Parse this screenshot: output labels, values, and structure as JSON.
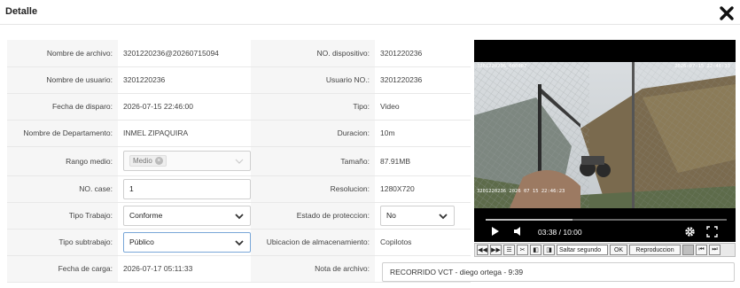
{
  "header": {
    "title": "Detalle",
    "close_icon": "close-x-icon"
  },
  "fields": {
    "nombre_archivo": {
      "label": "Nombre de archivo:",
      "value": "3201220236@20260715094"
    },
    "no_dispositivo": {
      "label": "NO. dispositivo:",
      "value": "3201220236"
    },
    "nombre_usuario": {
      "label": "Nombre de usuario:",
      "value": "3201220236"
    },
    "usuario_no": {
      "label": "Usuario NO.:",
      "value": "3201220236"
    },
    "fecha_disparo": {
      "label": "Fecha de disparo:",
      "value": "2026-07-15 22:46:00"
    },
    "tipo": {
      "label": "Tipo:",
      "value": "Video"
    },
    "nombre_departamento": {
      "label": "Nombre de Departamento:",
      "value": "INMEL ZIPAQUIRA"
    },
    "duracion": {
      "label": "Duracion:",
      "value": "10m"
    },
    "rango_medio": {
      "label": "Rango medio:",
      "value": "Medio"
    },
    "tamano": {
      "label": "Tamaño:",
      "value": "87.91MB"
    },
    "no_case": {
      "label": "NO. case:",
      "value": "1"
    },
    "resolucion": {
      "label": "Resolucion:",
      "value": "1280X720"
    },
    "tipo_trabajo": {
      "label": "Tipo Trabajo:",
      "value": "Conforme"
    },
    "estado_proteccion": {
      "label": "Estado de proteccion:",
      "value": "No"
    },
    "tipo_subtrabajo": {
      "label": "Tipo subtrabajo:",
      "value": "Público"
    },
    "ubicacion_almacenamiento": {
      "label": "Ubicacion de almacenamiento:",
      "value": "Copilotos"
    },
    "fecha_carga": {
      "label": "Fecha de carga:",
      "value": "2026-07-17 05:11:33"
    },
    "nota_archivo": {
      "label": "Nota de archivo:",
      "value": "RECORRIDO VCT - diego ortega - 9:39"
    }
  },
  "player": {
    "osd_left": "3201220236_000007",
    "osd_right": "2026-07-15 22:46:33",
    "osd_bottom_left": "3201220236 2026 07 15 22:46:23",
    "current_time": "03:38",
    "total_time": "10:00",
    "time_display": "03:38 / 10:00",
    "progress_fraction": 0.36
  },
  "toolbar": {
    "jump_input_placeholder": "Saltar segundo",
    "ok_label": "OK",
    "playback_label": "Reproduccion"
  },
  "colors": {
    "select_border_active": "#7aa7d8",
    "label_bg": "#f6f6f6"
  }
}
